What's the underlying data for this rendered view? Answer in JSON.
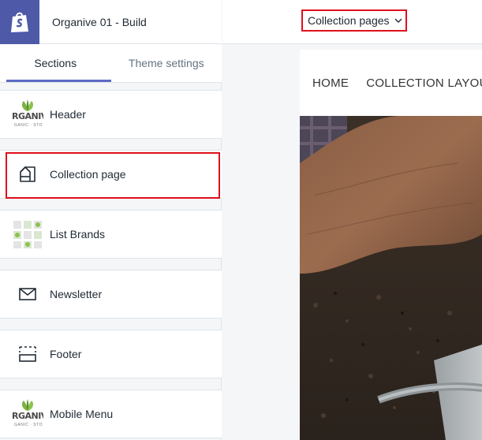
{
  "app": {
    "store_name": "Organive 01 - Build",
    "logo_icon": "shopify-bag-icon"
  },
  "tabs": [
    {
      "label": "Sections",
      "active": true
    },
    {
      "label": "Theme settings",
      "active": false
    }
  ],
  "sections": [
    {
      "label": "Header",
      "icon": "organive-logo-thumbnail",
      "thumb_text": "RGANIV",
      "thumb_sub": "GANIC · STO"
    },
    {
      "label": "Collection page",
      "icon": "collection-page-icon",
      "highlighted": true
    },
    {
      "label": "List Brands",
      "icon": "brand-logos-thumbnail"
    },
    {
      "label": "Newsletter",
      "icon": "envelope-icon"
    },
    {
      "label": "Footer",
      "icon": "footer-layout-icon"
    },
    {
      "label": "Mobile Menu",
      "icon": "organive-logo-thumbnail",
      "thumb_text": "RGANIV",
      "thumb_sub": "GANIC · STO"
    }
  ],
  "preview": {
    "page_selector": "Collection pages",
    "page_selector_highlighted": true,
    "nav_items": [
      "HOME",
      "COLLECTION LAYOUT"
    ]
  },
  "colors": {
    "highlight": "#e0101c",
    "accent": "#5c6ac4",
    "logo_bg": "#4e5aa8"
  }
}
